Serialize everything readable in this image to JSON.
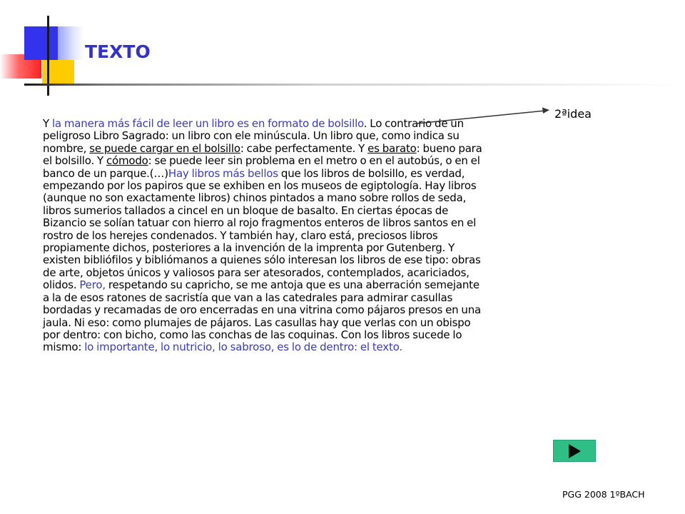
{
  "slide": {
    "title": "TEXTO",
    "annotation_label": "2ªidea",
    "footer": "PGG 2008 1ºBACH",
    "body": {
      "p01": "Y ",
      "p02": "la manera más fácil de leer un libro es en formato de bolsillo",
      "p03": ". Lo contrario de un peligroso Libro Sagrado: un libro con ele minúscula. Un libro que, como indica su nombre, ",
      "p04": "se puede cargar en el bolsillo",
      "p05": ": cabe perfectamente. Y ",
      "p06": "es barato",
      "p07": ": bueno para el bolsillo. Y ",
      "p08": "cómodo",
      "p09": ": se puede leer sin problema en el metro o en el autobús, o en el banco de un parque.(…)",
      "p10": "Hay libros más bellos",
      "p11": " que los libros de bolsillo, es verdad, empezando por los papiros que se exhiben en los museos de egiptología. Hay libros (aunque no son exactamente libros) chinos pintados a mano sobre rollos de seda, libros sumerios tallados a cincel en un bloque de basalto. En ciertas épocas de Bizancio se solían tatuar con hierro al rojo fragmentos enteros de libros santos en el rostro de los herejes condenados. Y también hay, claro está, preciosos libros propiamente dichos, posteriores a la invención de la imprenta por Gutenberg. Y existen bibliófilos y bibliómanos a quienes sólo interesan los libros de ese tipo: obras de arte, objetos únicos y valiosos para ser atesorados, contemplados, acariciados, olidos. ",
      "p12": "Pero,",
      "p13": " respetando su capricho, se me antoja que es una aberración semejante a la de esos ratones de sacristía que van a las catedrales para admirar casullas bordadas y recamadas de oro encerradas en una vitrina como pájaros presos en una jaula. Ni eso: como plumajes de pájaros. Las casullas hay que verlas con un obispo por dentro: con bicho, como las conchas de las coquinas. Con los libros sucede lo mismo: ",
      "p14": "lo importante, lo nutricio, lo sabroso, es lo de dentro: el texto."
    },
    "next_button": {
      "icon": "play-right-icon"
    }
  },
  "colors": {
    "title": "#3333cc",
    "highlight_text": "#3b3bb5",
    "button": "#2fbf86",
    "deco_blue": "#3333ee",
    "deco_yellow": "#ffcc00",
    "deco_red": "#ff2222"
  }
}
